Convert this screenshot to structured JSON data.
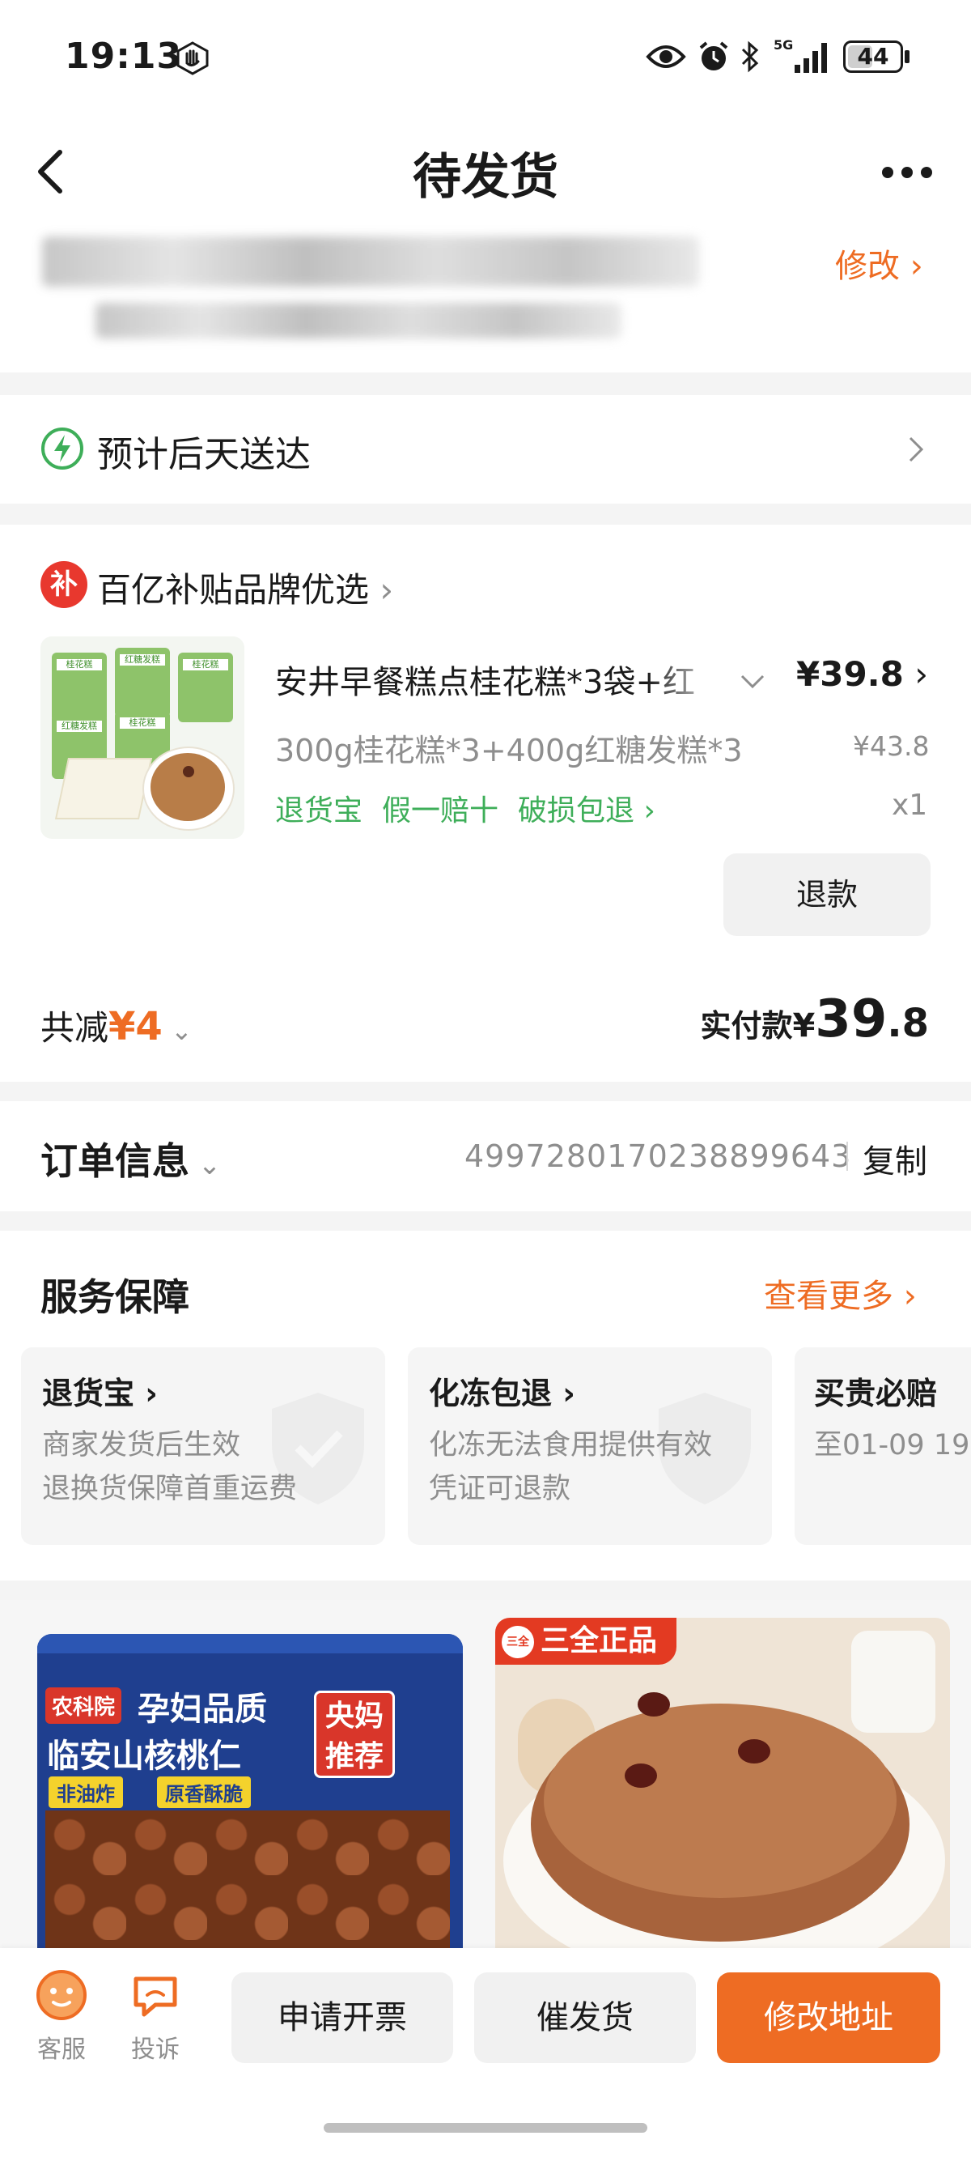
{
  "status_bar": {
    "time": "19:13",
    "battery": "44",
    "network": "5G"
  },
  "header": {
    "title": "待发货",
    "edit_label": "修改"
  },
  "delivery": {
    "text": "预计后天送达"
  },
  "store": {
    "badge": "补",
    "name": "百亿补贴品牌优选"
  },
  "product": {
    "title": "安井早餐糕点桂花糕*3袋+红",
    "price": "¥39.8",
    "spec": "300g桂花糕*3+400g红糖发糕*3",
    "original_price": "¥43.8",
    "tags": [
      "退货宝",
      "假一赔十",
      "破损包退"
    ],
    "quantity": "x1",
    "refund_label": "退款",
    "image_labels": [
      "桂花糕",
      "红糖发糕",
      "桂花糕",
      "红糖发糕",
      "桂花糕"
    ]
  },
  "summary": {
    "discount_label": "共减",
    "discount_value": "¥4",
    "paid_label": "实付款",
    "paid_currency": "¥",
    "paid_int": "39",
    "paid_dec": ".8"
  },
  "order_info": {
    "label": "订单信息",
    "order_no": "4997280170238899643",
    "copy_label": "复制"
  },
  "service": {
    "title": "服务保障",
    "more_label": "查看更多",
    "cards": [
      {
        "title": "退货宝",
        "lines": [
          "商家发货后生效",
          "退换货保障首重运费"
        ]
      },
      {
        "title": "化冻包退",
        "lines": [
          "化冻无法食用提供有效",
          "凭证可退款"
        ]
      },
      {
        "title": "买贵必赔",
        "lines": [
          "至01-09 19"
        ]
      }
    ]
  },
  "recommend": {
    "left": {
      "line1": "孕妇品质",
      "line2": "临安山核桃仁",
      "brand": "农科院",
      "tag1": "非油炸",
      "tag2": "原香酥脆",
      "badge": "央妈推荐"
    },
    "right": {
      "brand_logo": "三全",
      "label": "三全正品"
    }
  },
  "bottom_bar": {
    "service_label": "客服",
    "complaint_label": "投诉",
    "invoice_label": "申请开票",
    "urge_label": "催发货",
    "modify_label": "修改地址"
  },
  "colors": {
    "accent": "#ee6c23",
    "green": "#3eae59"
  }
}
